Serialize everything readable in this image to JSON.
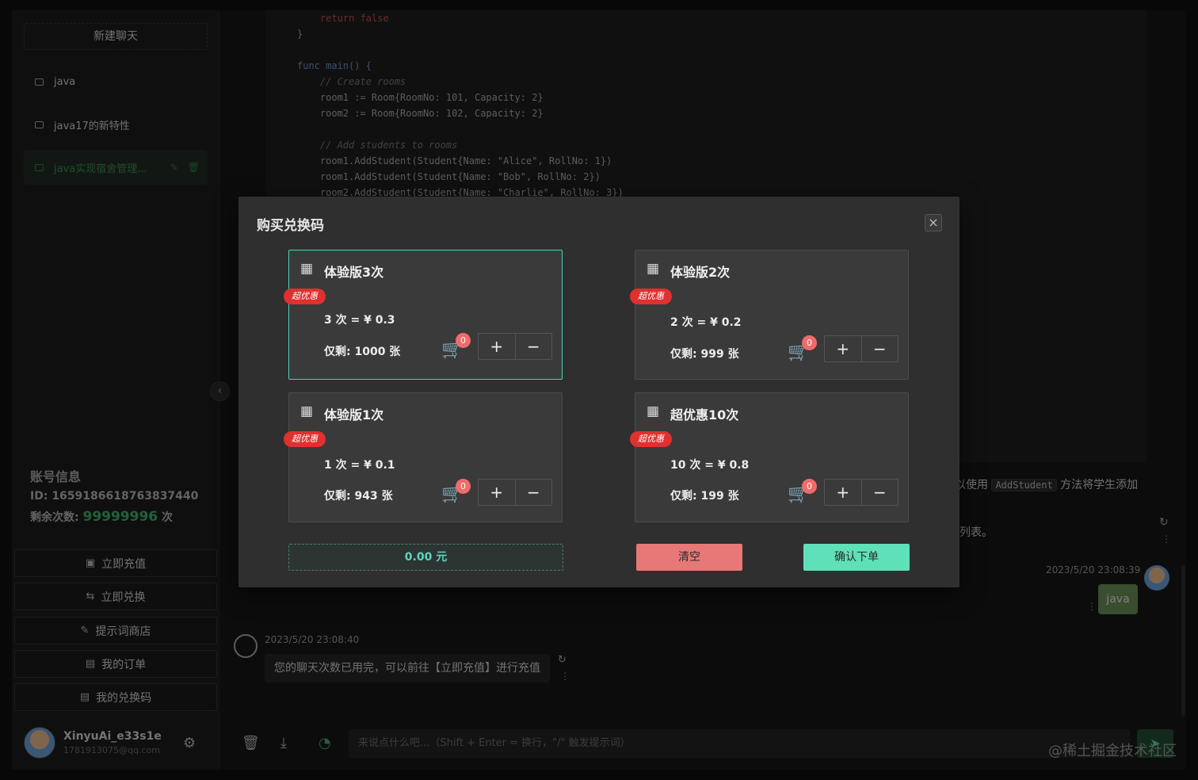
{
  "sidebar": {
    "new_chat": "新建聊天",
    "chats": [
      {
        "label": "java"
      },
      {
        "label": "java17的新特性"
      },
      {
        "label": "java实现宿舍管理..."
      }
    ],
    "account": {
      "title": "账号信息",
      "id_label": "ID:",
      "id_value": "1659186618763837440",
      "remaining_label": "剩余次数:",
      "remaining_value": "99999996",
      "remaining_unit": "次"
    },
    "buttons": [
      {
        "label": "立即充值",
        "icon": "recharge-icon"
      },
      {
        "label": "立即兑换",
        "icon": "exchange-icon"
      },
      {
        "label": "提示词商店",
        "icon": "store-icon"
      },
      {
        "label": "我的订单",
        "icon": "order-icon"
      },
      {
        "label": "我的兑换码",
        "icon": "code-icon"
      }
    ],
    "user": {
      "name": "XinyuAi_e33s1e",
      "email": "1781913075@qq.com"
    }
  },
  "code": {
    "lines": [
      {
        "text": "return false",
        "type": "kw"
      },
      {
        "text": "}",
        "type": "plain"
      },
      {
        "text": "",
        "type": "plain"
      },
      {
        "text": "func main() {",
        "type": "fn"
      },
      {
        "text": "    // Create rooms",
        "type": "cm"
      },
      {
        "text": "    room1 := Room{RoomNo: 101, Capacity: 2}",
        "type": "plain"
      },
      {
        "text": "    room2 := Room{RoomNo: 102, Capacity: 2}",
        "type": "plain"
      },
      {
        "text": "",
        "type": "plain"
      },
      {
        "text": "    // Add students to rooms",
        "type": "cm"
      },
      {
        "text": "    room1.AddStudent(Student{Name: \"Alice\", RollNo: 1})",
        "type": "plain"
      },
      {
        "text": "    room1.AddStudent(Student{Name: \"Bob\", RollNo: 2})",
        "type": "plain"
      },
      {
        "text": "    room2.AddStudent(Student{Name: \"Charlie\", RollNo: 3})",
        "type": "plain"
      }
    ]
  },
  "chat": {
    "ai_partial_pre": "以使用",
    "ai_partial_code": "AddStudent",
    "ai_partial_post": "方法将学生添加",
    "ai_partial_2": "列表。",
    "user_time": "2023/5/20 23:08:39",
    "user_msg": "java",
    "ai_time": "2023/5/20 23:08:40",
    "ai_msg": "您的聊天次数已用完，可以前往【立即充值】进行充值",
    "input_placeholder": "来说点什么吧...（Shift + Enter = 换行，\"/\" 触发提示词）",
    "watermark": "@稀土掘金技术社区"
  },
  "modal": {
    "title": "购买兑换码",
    "badge": "超优惠",
    "cards": [
      {
        "name": "体验版3次",
        "price": "3 次 = ¥ 0.3",
        "stock": "仅剩: 1000 张",
        "count": "0",
        "selected": true
      },
      {
        "name": "体验版2次",
        "price": "2 次 = ¥ 0.2",
        "stock": "仅剩: 999 张",
        "count": "0",
        "selected": false
      },
      {
        "name": "体验版1次",
        "price": "1 次 = ¥ 0.1",
        "stock": "仅剩: 943 张",
        "count": "0",
        "selected": false
      },
      {
        "name": "超优惠10次",
        "price": "10 次 = ¥ 0.8",
        "stock": "仅剩: 199 张",
        "count": "0",
        "selected": false
      }
    ],
    "plus": "+",
    "minus": "−",
    "total": "0.00 元",
    "clear": "清空",
    "confirm": "确认下单"
  },
  "colors": {
    "accent_green": "#3fb06a",
    "teal": "#5fe0b8",
    "red": "#e77877",
    "badge_red": "#e0302f"
  }
}
